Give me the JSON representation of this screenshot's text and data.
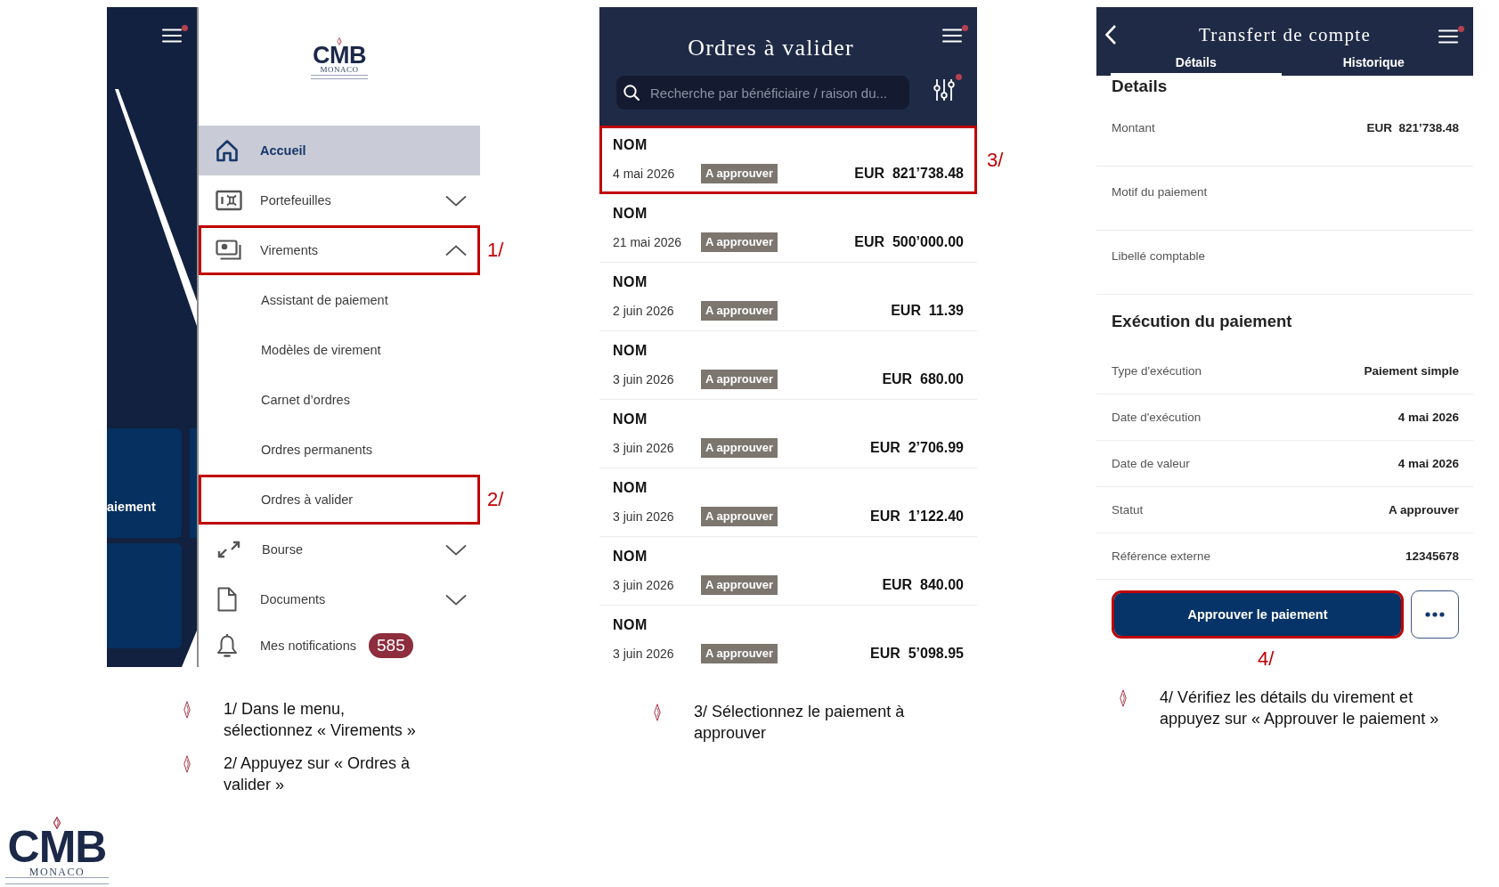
{
  "menu_screen": {
    "menu_button": {
      "alert": true
    },
    "background_tile": {
      "label": "aiement"
    },
    "logo": {
      "wordmark": "CMB",
      "subtitle": "MONACO"
    },
    "items": [
      {
        "kind": "link",
        "label": "Accueil",
        "selected": true
      },
      {
        "kind": "group",
        "label": "Portefeuilles",
        "selected": false,
        "expanded": false
      },
      {
        "kind": "group",
        "label": "Virements",
        "selected": false,
        "expanded": true,
        "callout": "1/",
        "children": [
          {
            "label": "Assistant de paiement",
            "selected": false
          },
          {
            "label": "Modèles de virement",
            "selected": false
          },
          {
            "label": "Carnet d’ordres",
            "selected": false
          },
          {
            "label": "Ordres permanents",
            "selected": false
          },
          {
            "label": "Ordres à valider",
            "selected": false,
            "callout": "2/"
          }
        ]
      },
      {
        "kind": "group",
        "label": "Bourse",
        "selected": false,
        "expanded": false
      },
      {
        "kind": "group",
        "label": "Documents",
        "selected": false,
        "expanded": false
      },
      {
        "kind": "link",
        "label": "Mes notifications",
        "selected": false,
        "badge": "585"
      }
    ],
    "steps": [
      "1/ Dans le menu, sélectionnez « Virements »",
      "2/ Appuyez sur « Ordres à valider »"
    ]
  },
  "orders_screen": {
    "title": "Ordres à valider",
    "menu_button": {
      "alert": true
    },
    "search": {
      "placeholder": "Recherche par bénéficiaire / raison du..."
    },
    "filter_button": {
      "alert": true
    },
    "orders": [
      {
        "name": "NOM",
        "date": "4 mai 2026",
        "status": "A approuver",
        "amount": "EUR  821’738.48",
        "callout": "3/"
      },
      {
        "name": "NOM",
        "date": "21 mai 2026",
        "status": "A approuver",
        "amount": "EUR  500’000.00"
      },
      {
        "name": "NOM",
        "date": "2 juin 2026",
        "status": "A approuver",
        "amount": "EUR  11.39"
      },
      {
        "name": "NOM",
        "date": "3 juin 2026",
        "status": "A approuver",
        "amount": "EUR  680.00"
      },
      {
        "name": "NOM",
        "date": "3 juin 2026",
        "status": "A approuver",
        "amount": "EUR  2’706.99"
      },
      {
        "name": "NOM",
        "date": "3 juin 2026",
        "status": "A approuver",
        "amount": "EUR  1’122.40"
      },
      {
        "name": "NOM",
        "date": "3 juin 2026",
        "status": "A approuver",
        "amount": "EUR  840.00"
      },
      {
        "name": "NOM",
        "date": "3 juin 2026",
        "status": "A approuver",
        "amount": "EUR  5’098.95"
      }
    ],
    "steps": [
      "3/ Sélectionnez le paiement à approuver"
    ]
  },
  "detail_screen": {
    "title": "Transfert de compte",
    "menu_button": {
      "alert": true
    },
    "tabs": [
      {
        "label": "Détails",
        "selected": true
      },
      {
        "label": "Historique",
        "selected": false
      }
    ],
    "section_heading": "Details",
    "fields": [
      {
        "label": "Montant",
        "value": "EUR  821’738.48"
      },
      {
        "label": "Motif du paiement"
      },
      {
        "label": "Libellé comptable"
      }
    ],
    "execution": {
      "heading": "Exécution du paiement",
      "fields": [
        {
          "label": "Type d'exécution",
          "value": "Paiement simple"
        },
        {
          "label": "Date d'exécution",
          "value": "4 mai 2026"
        },
        {
          "label": "Date de valeur",
          "value": "4 mai 2026"
        },
        {
          "label": "Statut",
          "value": "A approuver"
        },
        {
          "label": "Référence externe",
          "value": "12345678"
        }
      ]
    },
    "approve_button": {
      "label": "Approuver le paiement",
      "callout": "4/"
    },
    "steps": [
      "4/ Vérifiez les détails du virement et appuyez sur « Approuver le paiement »"
    ]
  },
  "footer_logo": {
    "wordmark": "CMB",
    "subtitle": "MONACO"
  }
}
